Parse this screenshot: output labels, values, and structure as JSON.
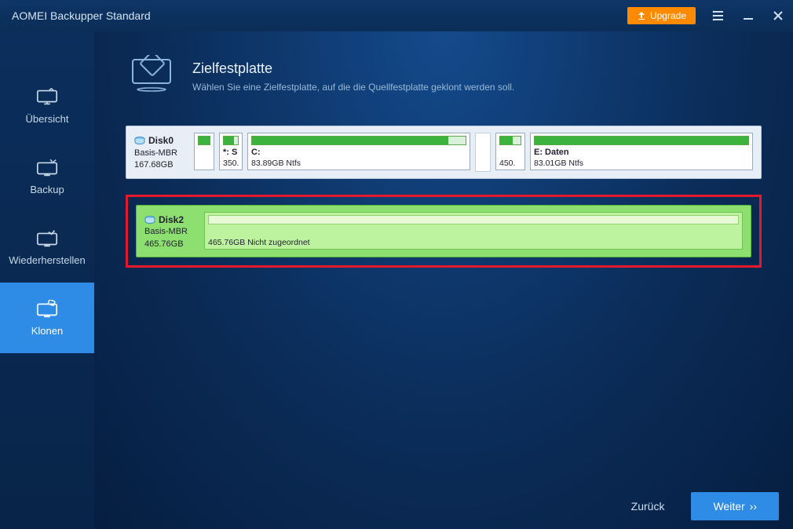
{
  "app": {
    "title": "AOMEI Backupper Standard"
  },
  "titlebar": {
    "upgrade": "Upgrade"
  },
  "sidebar": {
    "items": [
      {
        "label": "Übersicht"
      },
      {
        "label": "Backup"
      },
      {
        "label": "Wiederherstellen"
      },
      {
        "label": "Klonen"
      }
    ]
  },
  "header": {
    "title": "Zielfestplatte",
    "subtitle": "Wählen Sie eine Zielfestplatte, auf die die Quellfestplatte geklont werden soll."
  },
  "disk0": {
    "name": "Disk0",
    "type": "Basis-MBR",
    "size": "167.68GB",
    "p1": {
      "label": "*: S",
      "size": "350."
    },
    "p2": {
      "label": "C:",
      "cap": "83.89GB Ntfs"
    },
    "p3": {
      "size": "450."
    },
    "p4": {
      "label": "E: Daten",
      "cap": "83.01GB Ntfs"
    }
  },
  "disk2": {
    "name": "Disk2",
    "type": "Basis-MBR",
    "size": "465.76GB",
    "part": {
      "cap": "465.76GB Nicht zugeordnet"
    }
  },
  "footer": {
    "back": "Zurück",
    "next": "Weiter"
  }
}
